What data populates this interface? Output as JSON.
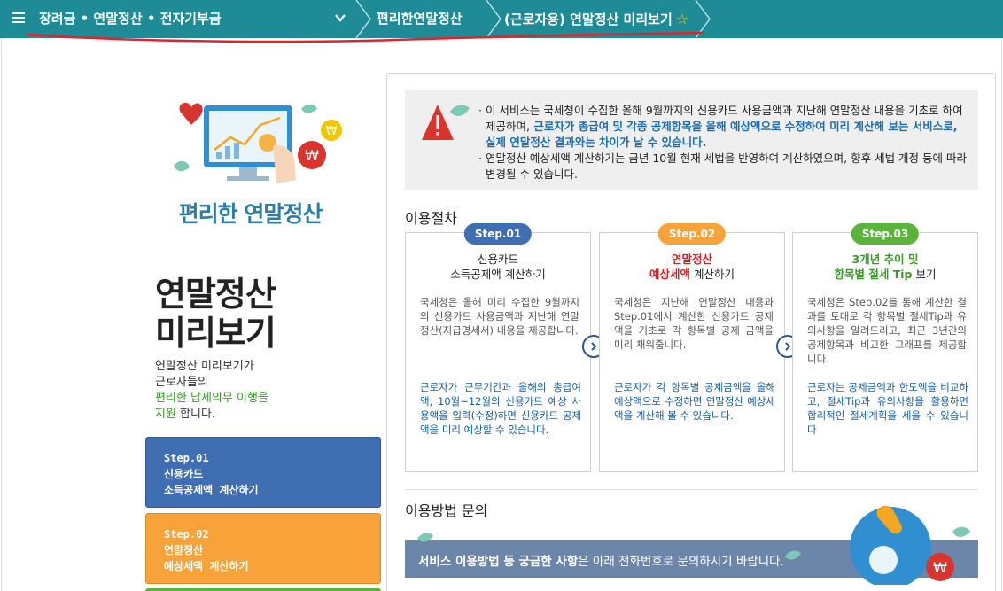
{
  "topbar": {
    "category": "장려금 • 연말정산 • 전자기부금",
    "crumb2": "편리한연말정산",
    "crumb3": "(근로자용) 연말정산 미리보기",
    "star": "☆",
    "bg_color": "#1f8b97"
  },
  "left": {
    "brand": "편리한 연말정산",
    "title_line1": "연말정산",
    "title_line2": "미리보기",
    "desc_line1": "연말정산 미리보기가",
    "desc_line2": "근로자들의",
    "desc_line3_green": "편리한 납세의무 이행을",
    "desc_line4_green": "지원",
    "desc_line4_rest": " 합니다.",
    "steps": [
      {
        "line1": "Step.01",
        "line2": "신용카드",
        "line3": "소득공제액 계산하기",
        "color": "#3f6eb2"
      },
      {
        "line1": "Step.02",
        "line2": "연말정산",
        "line3": "예상세액 계산하기",
        "color": "#f8a23a"
      }
    ]
  },
  "notice": {
    "p1_a": "이 서비스는 국세청이 수집한 올해 9월까지의 신용카드 사용금액과 지난해 연말정산 내용을 기초로 하여 제공하며,",
    "p1_b": " 근로자가 총급여 및 각종 공제항목을 올해 예상액으로 수정하여 미리 계산해 보는 서비스로, 실제 연말정산 결과와는 차이가 날 수 있습니다.",
    "p2": "연말정산 예상세액 계산하기는 금년 10월 현재 세법을 반영하여 계산하였으며, 향후 세법 개정 등에 따라 변경될 수 있습니다."
  },
  "procedure": {
    "title": "이용절차",
    "cards": [
      {
        "badge": "Step.01",
        "badge_color": "#3f6eb2",
        "title_line1": "신용카드",
        "title_line2": "소득공제액 계산하기",
        "body": "국세청은 올해 미리 수집한 9월까지의 신용카드 사용금액과 지난해 연말정산(지급명세서) 내용을 제공합니다.",
        "blue": "근로자가 근무기간과 올해의 총급여액, 10월~12월의 신용카드 예상 사용액을 입력(수정)하면 신용카드 공제액을 미리 예상할 수 있습니다."
      },
      {
        "badge": "Step.02",
        "badge_color": "#f8a23a",
        "title_line1_red": "연말정산",
        "title_line2_red": "예상세액",
        "title_line2_rest": " 계산하기",
        "body": "국세청은 지난해 연말정산 내용과 Step.01에서 계산한 신용카드 공제액을 기초로 각 항목별 공제 금액을 미리 채워줍니다.",
        "blue": "근로자가 각 항목별 공제금액을 올해예상액으로 수정하면 연말정산 예상세액을 계산해 볼 수 있습니다."
      },
      {
        "badge": "Step.03",
        "badge_color": "#5ab43a",
        "title_line1_green": "3개년 추이 및",
        "title_line2_green": "항목별 절세 Tip",
        "title_line2_rest": " 보기",
        "body": "국세청은 Step.02를 통해 계산한 결과를 토대로 각 항목별 절세Tip과 유의사항을 알려드리고, 최근 3년간의 공제항목과 비교한 그래프를 제공합니다.",
        "blue": "근로자는 공제금액과 한도액을 비교하고, 절세Tip과 유의사항을 활용하면 합리적인 절세계획을 세울 수 있습니다"
      }
    ]
  },
  "inquiry": {
    "title": "이용방법 문의",
    "banner_bold": "서비스 이용방법 등 궁금한 사항",
    "banner_rest": "은 아래 전화번호로 문의하시기 바랍니다."
  }
}
